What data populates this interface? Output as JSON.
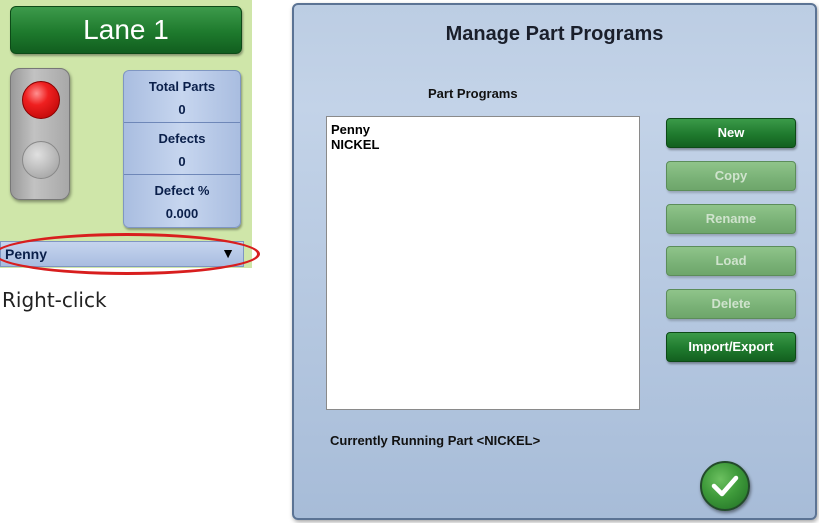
{
  "lane": {
    "title": "Lane 1",
    "stats": [
      {
        "label": "Total Parts",
        "value": "0"
      },
      {
        "label": "Defects",
        "value": "0"
      },
      {
        "label": "Defect %",
        "value": "0.000"
      }
    ],
    "selected_part": "Penny",
    "dropdown_icon": "triangle-down-icon",
    "light_colors": {
      "active": "#e01818",
      "inactive": "#b5b5b5"
    }
  },
  "caption": "Right-click",
  "dialog": {
    "title": "Manage Part Programs",
    "list_label": "Part Programs",
    "programs": [
      "Penny",
      "NICKEL"
    ],
    "buttons": {
      "new": "New",
      "copy": "Copy",
      "rename": "Rename",
      "load": "Load",
      "delete": "Delete",
      "import_export": "Import/Export"
    },
    "running_text": "Currently Running Part <NICKEL>",
    "ok_icon": "checkmark-icon"
  },
  "colors": {
    "accent_green": "#1f7a2e",
    "highlight_red": "#d81e1e",
    "dialog_bg": "#bccde3"
  }
}
